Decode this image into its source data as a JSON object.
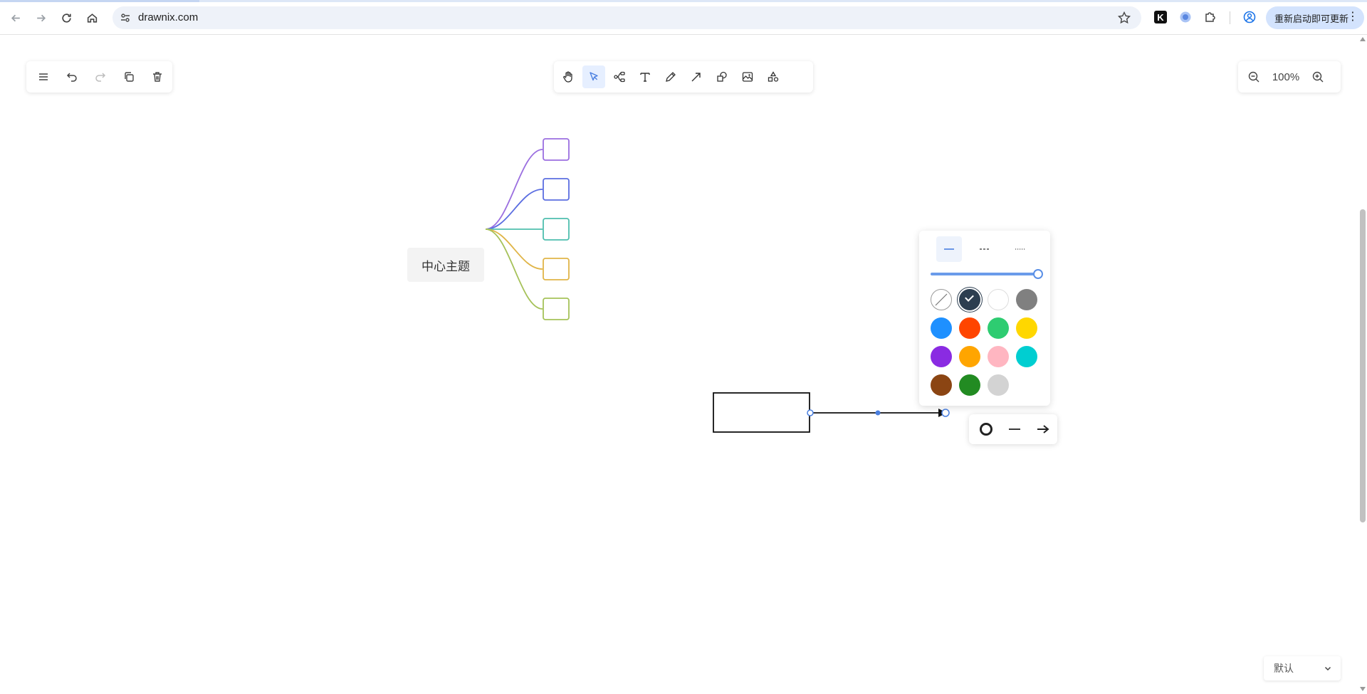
{
  "browser": {
    "url": "drawnix.com",
    "update_button_label": "重新启动即可更新",
    "menu_glyph": "⋮",
    "nav": {
      "back_icon": "arrow-left-icon",
      "forward_icon": "arrow-right-icon",
      "reload_icon": "reload-icon",
      "home_icon": "home-icon"
    },
    "extensions": [
      "k-extension-icon",
      "translate-extension-icon",
      "puzzle-extension-icon",
      "profile-icon"
    ]
  },
  "left_toolbar": {
    "items": [
      "menu-icon",
      "undo-icon",
      "redo-icon",
      "duplicate-icon",
      "delete-icon"
    ]
  },
  "main_toolbar": {
    "items": [
      "hand-icon",
      "pointer-icon",
      "mind-map-icon",
      "text-icon",
      "pen-icon",
      "arrow-icon",
      "shape-icon",
      "image-icon",
      "more-shapes-icon"
    ],
    "active": "pointer-icon"
  },
  "zoom": {
    "level": "100%"
  },
  "mind_map": {
    "center_label": "中心主题",
    "branch_colors": [
      "#9b6fe0",
      "#5b6ee1",
      "#4fbfae",
      "#e0b548",
      "#a6c25a"
    ]
  },
  "style_popover": {
    "line_types": [
      "solid",
      "dashed",
      "dotted"
    ],
    "active_line_type": "solid",
    "opacity_percent": 100,
    "colors": [
      "transparent",
      "#2c3e50",
      "#ffffff",
      "#808080",
      "#1e90ff",
      "#ff4500",
      "#2ecc71",
      "#ffd700",
      "#8a2be2",
      "#ffa500",
      "#ffb6c1",
      "#00ced1",
      "#8b4513",
      "#228b22",
      "#d3d3d3"
    ],
    "selected_color": "#2c3e50"
  },
  "arrow_popover": {
    "items": [
      "end-none-icon",
      "line-icon",
      "arrow-end-icon"
    ]
  },
  "theme_select": {
    "value": "默认"
  }
}
